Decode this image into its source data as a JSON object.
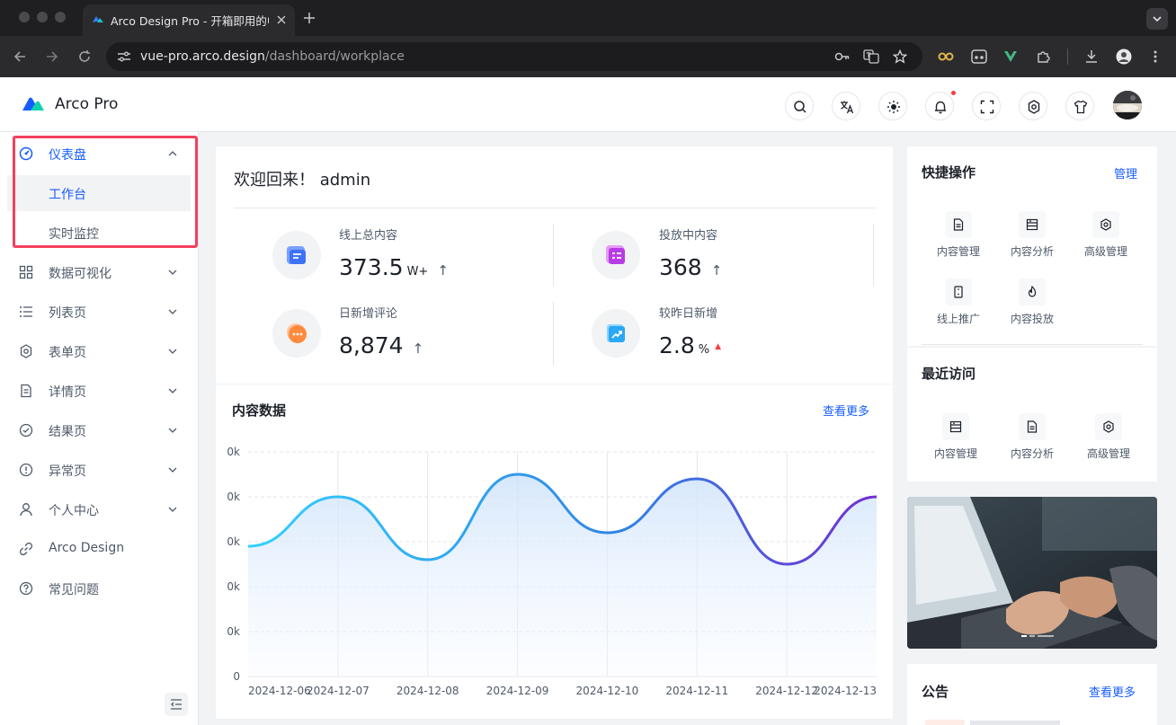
{
  "browser": {
    "tab_title": "Arco Design Pro - 开箱即用的中台前端解决方案",
    "url_host": "vue-pro.arco.design",
    "url_path": "/dashboard/workplace"
  },
  "header": {
    "logo_text": "Arco Pro"
  },
  "sidebar": {
    "items": [
      {
        "label": "仪表盘"
      },
      {
        "label": "工作台"
      },
      {
        "label": "实时监控"
      },
      {
        "label": "数据可视化"
      },
      {
        "label": "列表页"
      },
      {
        "label": "表单页"
      },
      {
        "label": "详情页"
      },
      {
        "label": "结果页"
      },
      {
        "label": "异常页"
      },
      {
        "label": "个人中心"
      },
      {
        "label": "Arco Design"
      },
      {
        "label": "常见问题"
      }
    ]
  },
  "welcome": {
    "title": "欢迎回来！ admin"
  },
  "stats": [
    {
      "label": "线上总内容",
      "value": "373.5",
      "unit": "W+",
      "trend": "↑"
    },
    {
      "label": "投放中内容",
      "value": "368",
      "unit": "",
      "trend": "↑"
    },
    {
      "label": "日新增评论",
      "value": "8,874",
      "unit": "",
      "trend": "↑"
    },
    {
      "label": "较昨日新增",
      "value": "2.8",
      "unit": "%",
      "trend": "▲"
    }
  ],
  "content_card": {
    "title": "内容数据",
    "more": "查看更多"
  },
  "chart_data": {
    "type": "area",
    "title": "内容数据",
    "x": [
      "2024-12-06",
      "2024-12-07",
      "2024-12-08",
      "2024-12-09",
      "2024-12-10",
      "2024-12-11",
      "2024-12-12",
      "2024-12-13"
    ],
    "y_tick_labels": [
      "0",
      "0k",
      "0k",
      "0k",
      "0k",
      "0k"
    ],
    "series": [
      {
        "values": [
          2.9,
          4.0,
          2.6,
          4.5,
          3.2,
          4.4,
          2.5,
          4.0
        ],
        "color_start": "#33d1ff",
        "color_end": "#722ed1"
      }
    ],
    "ylim": [
      0,
      5
    ],
    "grid": true
  },
  "quick_ops": {
    "title": "快捷操作",
    "manage": "管理",
    "items": [
      {
        "label": "内容管理",
        "icon": "file-icon"
      },
      {
        "label": "内容分析",
        "icon": "storage-icon"
      },
      {
        "label": "高级管理",
        "icon": "settings-icon"
      },
      {
        "label": "线上推广",
        "icon": "mobile-icon"
      },
      {
        "label": "内容投放",
        "icon": "fire-icon"
      }
    ]
  },
  "recent": {
    "title": "最近访问",
    "items": [
      {
        "label": "内容管理",
        "icon": "storage-icon"
      },
      {
        "label": "内容分析",
        "icon": "file-icon"
      },
      {
        "label": "高级管理",
        "icon": "settings-icon"
      }
    ]
  },
  "notice": {
    "title": "公告",
    "more": "查看更多"
  },
  "colors": {
    "primary": "#165dff",
    "highlight_box": "#f53f5d",
    "trend_up": "#f53f3f"
  }
}
